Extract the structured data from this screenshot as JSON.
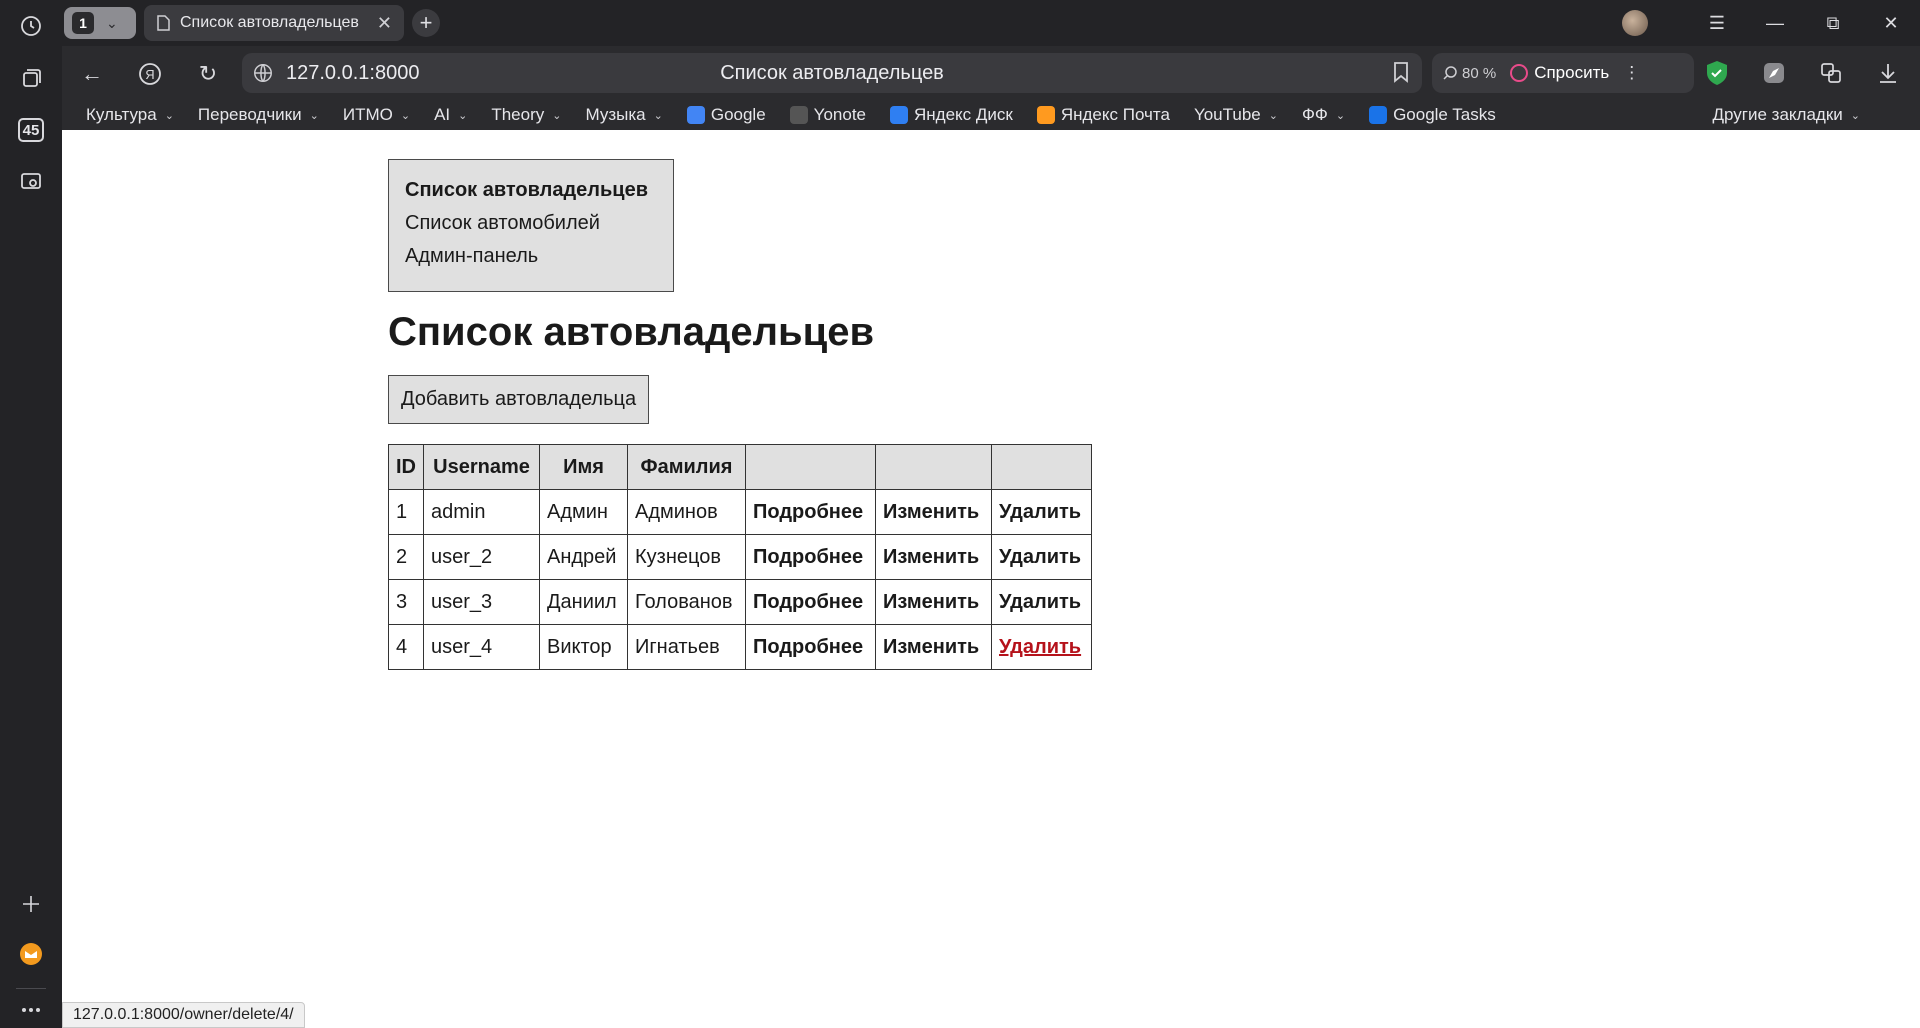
{
  "sidebar": {
    "badge": "45",
    "icons": [
      "history-icon",
      "collections-icon",
      "notes-icon",
      "screenshot-icon",
      "add-icon",
      "mail-icon",
      "more-icon"
    ]
  },
  "tabs": {
    "group_count": "1",
    "active_tab_title": "Список автовладельцев"
  },
  "navbar": {
    "url": "127.0.0.1:8000",
    "page_title": "Список автовладельцев",
    "zoom": "80 %",
    "ask_label": "Спросить"
  },
  "bookmarks": [
    {
      "label": "Культура",
      "folder": true
    },
    {
      "label": "Переводчики",
      "folder": true
    },
    {
      "label": "ИТМО",
      "folder": true
    },
    {
      "label": "AI",
      "folder": true
    },
    {
      "label": "Theory",
      "folder": true
    },
    {
      "label": "Музыка",
      "folder": true
    },
    {
      "label": "Google",
      "folder": false,
      "icon": "google-icon",
      "color": "#4285f4"
    },
    {
      "label": "Yonote",
      "folder": false,
      "icon": "yonote-icon",
      "color": "#555555"
    },
    {
      "label": "Яндекс Диск",
      "folder": false,
      "icon": "yandex-disk-icon",
      "color": "#2f7ff2"
    },
    {
      "label": "Яндекс Почта",
      "folder": false,
      "icon": "yandex-mail-icon",
      "color": "#ff9a1f"
    },
    {
      "label": "YouTube",
      "folder": true
    },
    {
      "label": "ФФ",
      "folder": true
    },
    {
      "label": "Google Tasks",
      "folder": false,
      "icon": "google-tasks-icon",
      "color": "#1a73e8"
    }
  ],
  "bookmarks_other": "Другие закладки",
  "page": {
    "menu": {
      "owners": "Список автовладельцев",
      "cars": "Список автомобилей",
      "admin": "Админ-панель"
    },
    "heading": "Список автовладельцев",
    "add_button": "Добавить автовладельца",
    "table": {
      "headers": [
        "ID",
        "Username",
        "Имя",
        "Фамилия",
        "",
        "",
        ""
      ],
      "rows": [
        [
          "1",
          "admin",
          "Админ",
          "Админов",
          "Подробнее",
          "Изменить",
          "Удалить"
        ],
        [
          "2",
          "user_2",
          "Андрей",
          "Кузнецов",
          "Подробнее",
          "Изменить",
          "Удалить"
        ],
        [
          "3",
          "user_3",
          "Даниил",
          "Голованов",
          "Подробнее",
          "Изменить",
          "Удалить"
        ],
        [
          "4",
          "user_4",
          "Виктор",
          "Игнатьев",
          "Подробнее",
          "Изменить",
          "Удалить"
        ]
      ]
    }
  },
  "status_url": "127.0.0.1:8000/owner/delete/4/",
  "colors": {
    "hover_link": "#b5121b",
    "shield": "#2fa84f"
  }
}
